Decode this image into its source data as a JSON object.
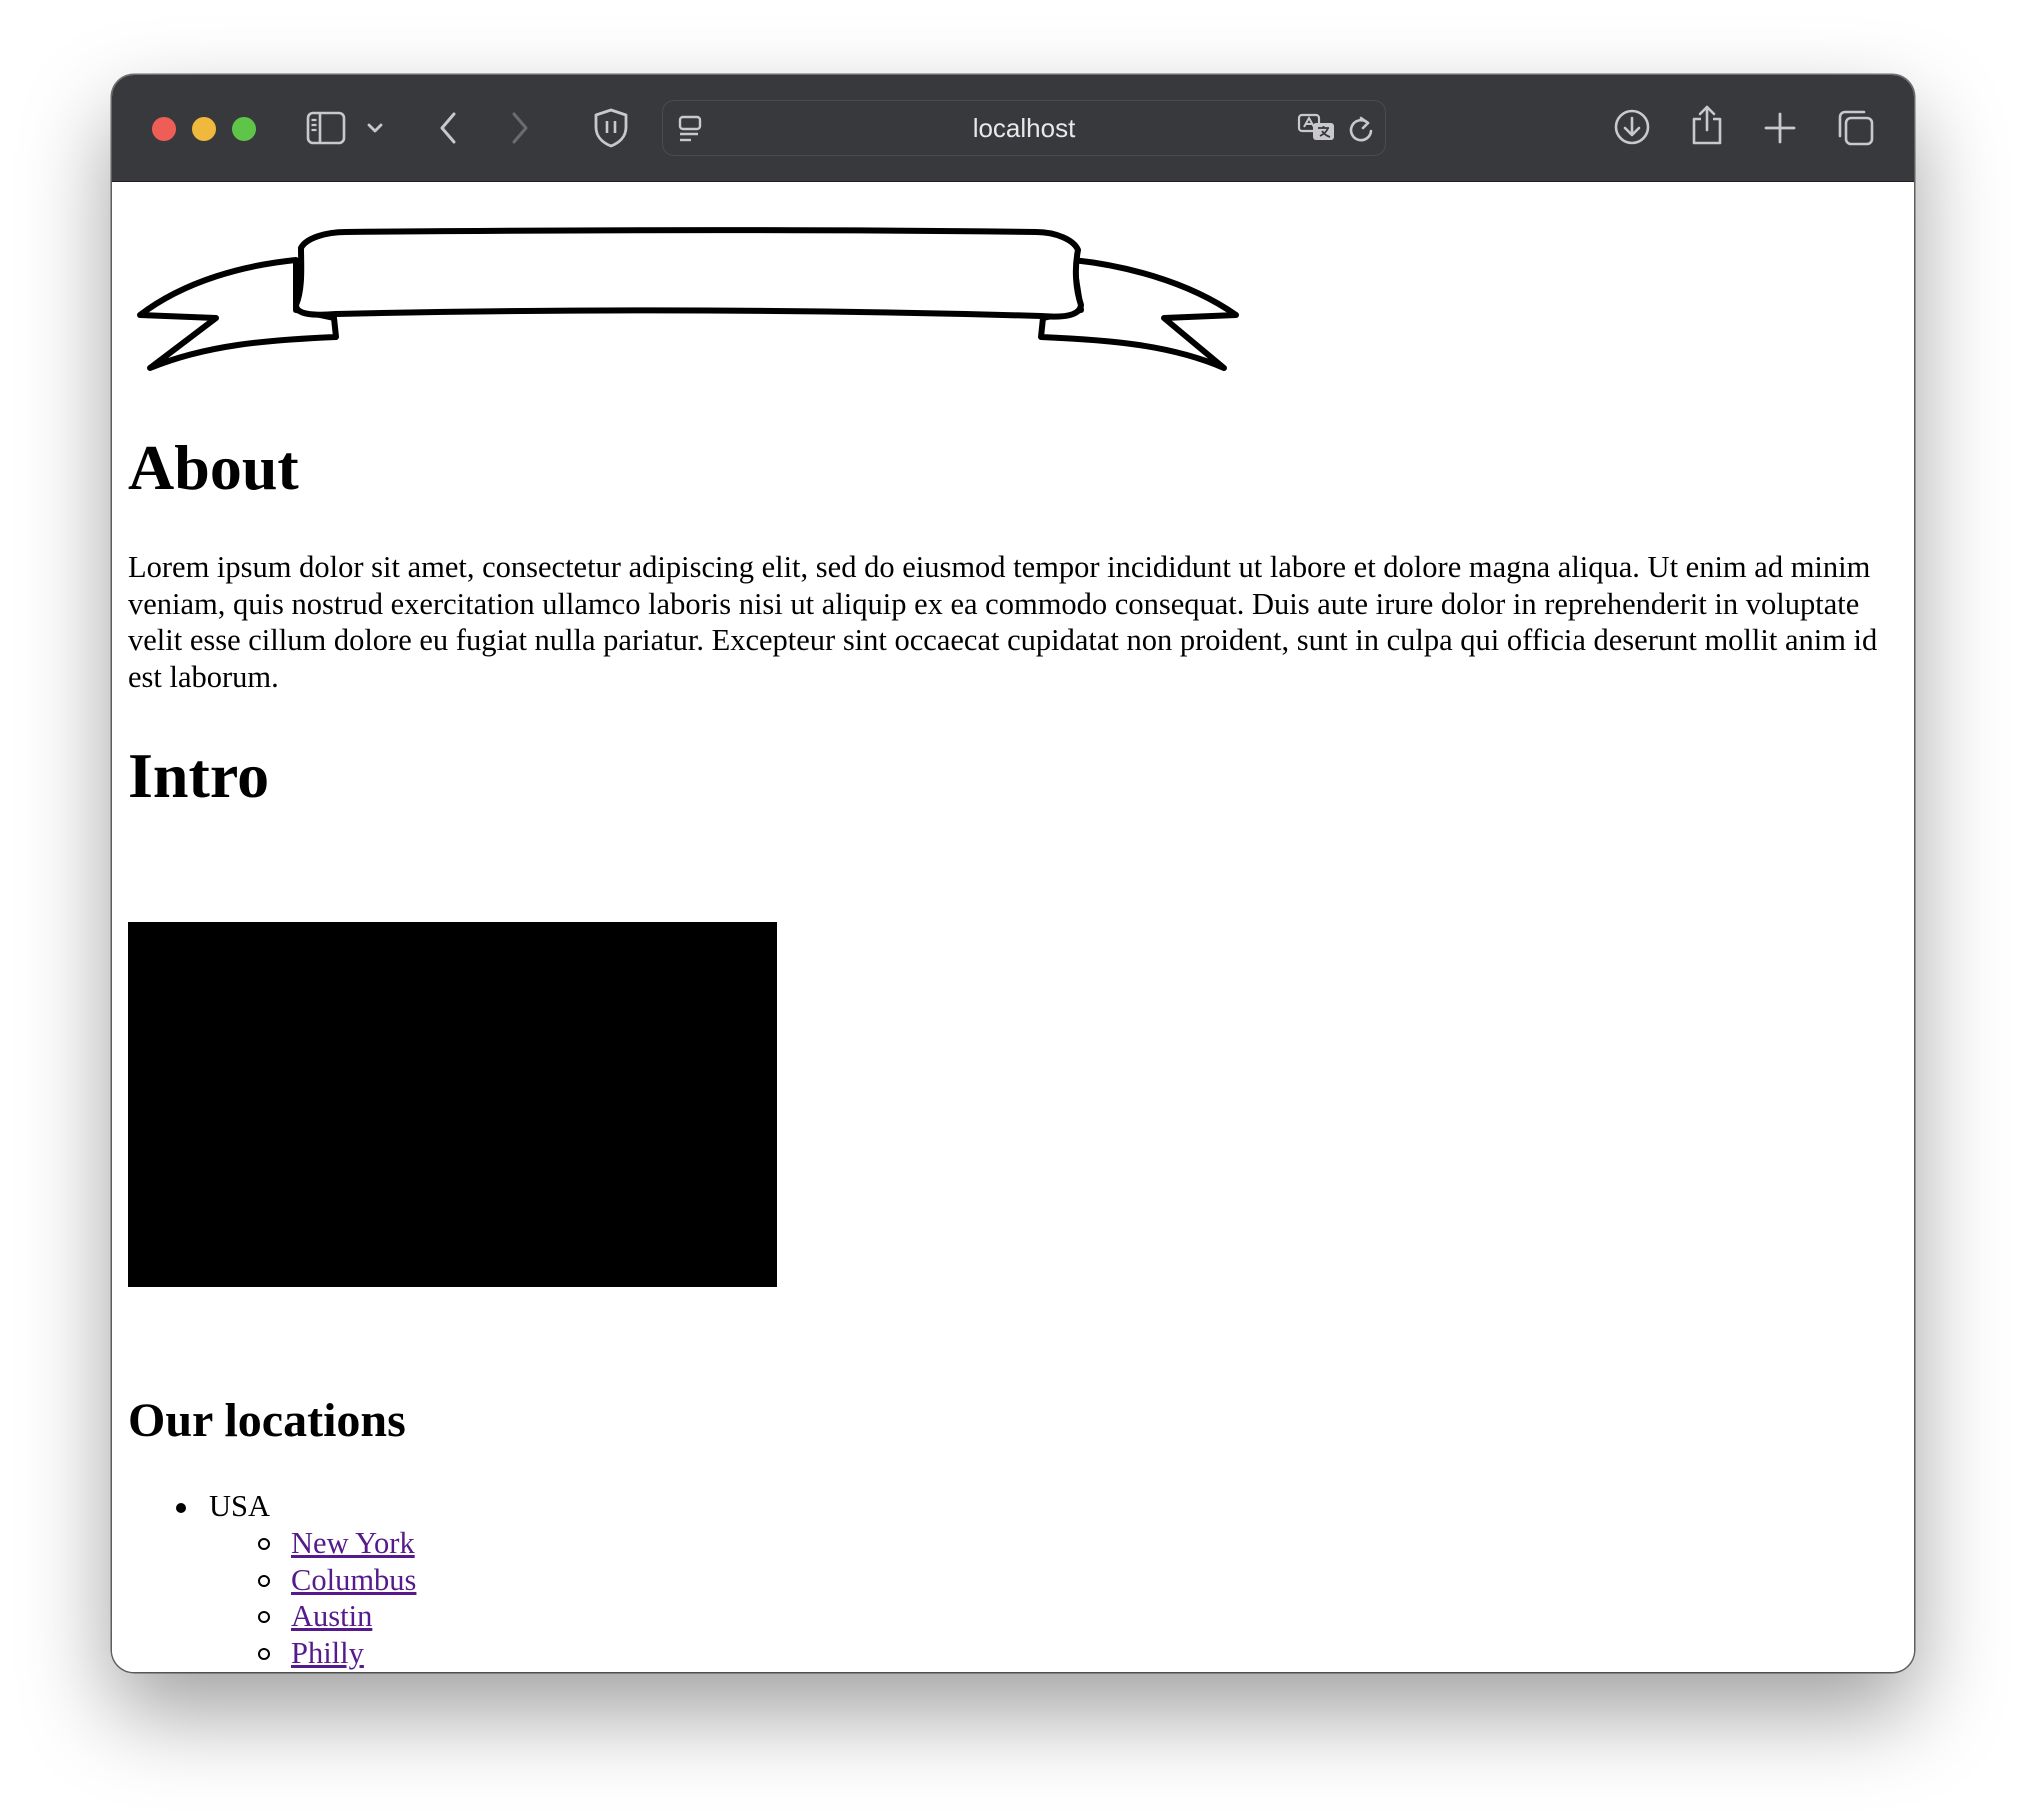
{
  "browser": {
    "address": "localhost"
  },
  "page": {
    "about_title": "About",
    "about_text": "Lorem ipsum dolor sit amet, consectetur adipiscing elit, sed do eiusmod tempor incididunt ut labore et dolore magna aliqua. Ut enim ad minim veniam, quis nostrud exercitation ullamco laboris nisi ut aliquip ex ea commodo consequat. Duis aute irure dolor in reprehenderit in voluptate velit esse cillum dolore eu fugiat nulla pariatur. Excepteur sint occaecat cupidatat non proident, sunt in culpa qui officia deserunt mollit anim id est laborum.",
    "intro_title": "Intro",
    "locations_title": "Our locations",
    "locations": {
      "country": "USA",
      "cities": [
        "New York",
        "Columbus",
        "Austin",
        "Philly"
      ]
    }
  },
  "colors": {
    "toolbar": "#38393c",
    "link_visited": "#551a8b",
    "traffic_red": "#ee5e56",
    "traffic_yellow": "#f0b83c",
    "traffic_green": "#5ec549"
  }
}
